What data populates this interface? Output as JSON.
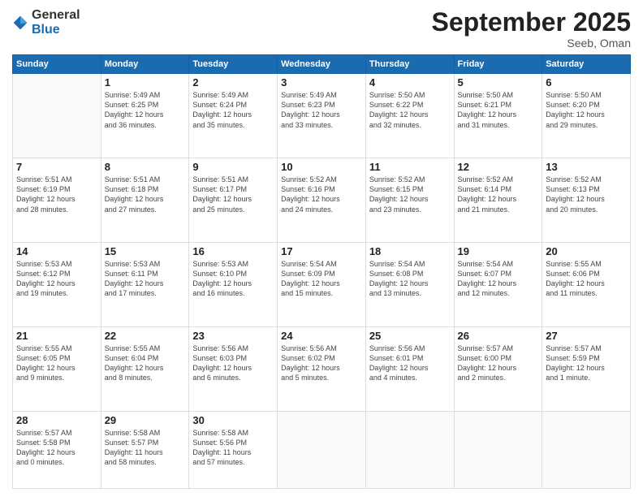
{
  "header": {
    "logo_general": "General",
    "logo_blue": "Blue",
    "title": "September 2025",
    "location": "Seeb, Oman"
  },
  "weekdays": [
    "Sunday",
    "Monday",
    "Tuesday",
    "Wednesday",
    "Thursday",
    "Friday",
    "Saturday"
  ],
  "weeks": [
    [
      {
        "day": "",
        "info": ""
      },
      {
        "day": "1",
        "info": "Sunrise: 5:49 AM\nSunset: 6:25 PM\nDaylight: 12 hours\nand 36 minutes."
      },
      {
        "day": "2",
        "info": "Sunrise: 5:49 AM\nSunset: 6:24 PM\nDaylight: 12 hours\nand 35 minutes."
      },
      {
        "day": "3",
        "info": "Sunrise: 5:49 AM\nSunset: 6:23 PM\nDaylight: 12 hours\nand 33 minutes."
      },
      {
        "day": "4",
        "info": "Sunrise: 5:50 AM\nSunset: 6:22 PM\nDaylight: 12 hours\nand 32 minutes."
      },
      {
        "day": "5",
        "info": "Sunrise: 5:50 AM\nSunset: 6:21 PM\nDaylight: 12 hours\nand 31 minutes."
      },
      {
        "day": "6",
        "info": "Sunrise: 5:50 AM\nSunset: 6:20 PM\nDaylight: 12 hours\nand 29 minutes."
      }
    ],
    [
      {
        "day": "7",
        "info": "Sunrise: 5:51 AM\nSunset: 6:19 PM\nDaylight: 12 hours\nand 28 minutes."
      },
      {
        "day": "8",
        "info": "Sunrise: 5:51 AM\nSunset: 6:18 PM\nDaylight: 12 hours\nand 27 minutes."
      },
      {
        "day": "9",
        "info": "Sunrise: 5:51 AM\nSunset: 6:17 PM\nDaylight: 12 hours\nand 25 minutes."
      },
      {
        "day": "10",
        "info": "Sunrise: 5:52 AM\nSunset: 6:16 PM\nDaylight: 12 hours\nand 24 minutes."
      },
      {
        "day": "11",
        "info": "Sunrise: 5:52 AM\nSunset: 6:15 PM\nDaylight: 12 hours\nand 23 minutes."
      },
      {
        "day": "12",
        "info": "Sunrise: 5:52 AM\nSunset: 6:14 PM\nDaylight: 12 hours\nand 21 minutes."
      },
      {
        "day": "13",
        "info": "Sunrise: 5:52 AM\nSunset: 6:13 PM\nDaylight: 12 hours\nand 20 minutes."
      }
    ],
    [
      {
        "day": "14",
        "info": "Sunrise: 5:53 AM\nSunset: 6:12 PM\nDaylight: 12 hours\nand 19 minutes."
      },
      {
        "day": "15",
        "info": "Sunrise: 5:53 AM\nSunset: 6:11 PM\nDaylight: 12 hours\nand 17 minutes."
      },
      {
        "day": "16",
        "info": "Sunrise: 5:53 AM\nSunset: 6:10 PM\nDaylight: 12 hours\nand 16 minutes."
      },
      {
        "day": "17",
        "info": "Sunrise: 5:54 AM\nSunset: 6:09 PM\nDaylight: 12 hours\nand 15 minutes."
      },
      {
        "day": "18",
        "info": "Sunrise: 5:54 AM\nSunset: 6:08 PM\nDaylight: 12 hours\nand 13 minutes."
      },
      {
        "day": "19",
        "info": "Sunrise: 5:54 AM\nSunset: 6:07 PM\nDaylight: 12 hours\nand 12 minutes."
      },
      {
        "day": "20",
        "info": "Sunrise: 5:55 AM\nSunset: 6:06 PM\nDaylight: 12 hours\nand 11 minutes."
      }
    ],
    [
      {
        "day": "21",
        "info": "Sunrise: 5:55 AM\nSunset: 6:05 PM\nDaylight: 12 hours\nand 9 minutes."
      },
      {
        "day": "22",
        "info": "Sunrise: 5:55 AM\nSunset: 6:04 PM\nDaylight: 12 hours\nand 8 minutes."
      },
      {
        "day": "23",
        "info": "Sunrise: 5:56 AM\nSunset: 6:03 PM\nDaylight: 12 hours\nand 6 minutes."
      },
      {
        "day": "24",
        "info": "Sunrise: 5:56 AM\nSunset: 6:02 PM\nDaylight: 12 hours\nand 5 minutes."
      },
      {
        "day": "25",
        "info": "Sunrise: 5:56 AM\nSunset: 6:01 PM\nDaylight: 12 hours\nand 4 minutes."
      },
      {
        "day": "26",
        "info": "Sunrise: 5:57 AM\nSunset: 6:00 PM\nDaylight: 12 hours\nand 2 minutes."
      },
      {
        "day": "27",
        "info": "Sunrise: 5:57 AM\nSunset: 5:59 PM\nDaylight: 12 hours\nand 1 minute."
      }
    ],
    [
      {
        "day": "28",
        "info": "Sunrise: 5:57 AM\nSunset: 5:58 PM\nDaylight: 12 hours\nand 0 minutes."
      },
      {
        "day": "29",
        "info": "Sunrise: 5:58 AM\nSunset: 5:57 PM\nDaylight: 11 hours\nand 58 minutes."
      },
      {
        "day": "30",
        "info": "Sunrise: 5:58 AM\nSunset: 5:56 PM\nDaylight: 11 hours\nand 57 minutes."
      },
      {
        "day": "",
        "info": ""
      },
      {
        "day": "",
        "info": ""
      },
      {
        "day": "",
        "info": ""
      },
      {
        "day": "",
        "info": ""
      }
    ]
  ]
}
